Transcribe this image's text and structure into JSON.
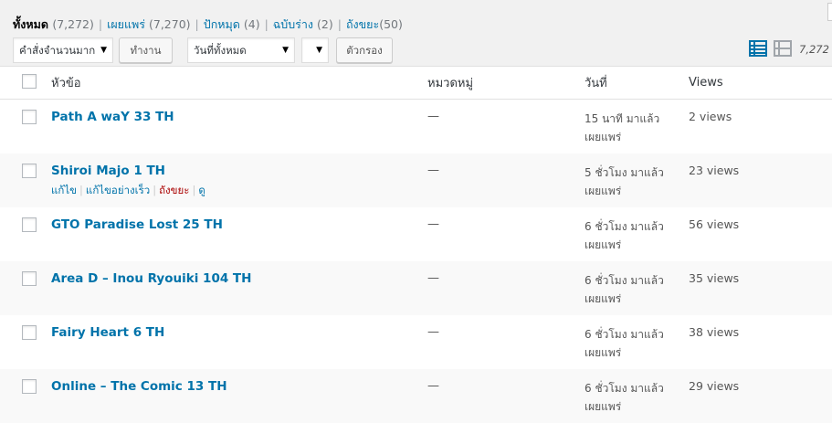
{
  "filters": {
    "all": {
      "label": "ทั้งหมด",
      "count": "(7,272)"
    },
    "published": {
      "label": "เผยแพร่",
      "count": "(7,270)"
    },
    "sticky": {
      "label": "ปักหมุด",
      "count": "(4)"
    },
    "drafts": {
      "label": "ฉบับร่าง",
      "count": "(2)"
    },
    "trash": {
      "label": "ถังขยะ",
      "count": "(50)"
    }
  },
  "toolbar": {
    "bulk_action": "คำสั่งจำนวนมาก",
    "apply_label": "ทำงาน",
    "date_filter": "วันที่ทั้งหมด",
    "category_filter": "",
    "filter_label": "ตัวกรอง",
    "items_count": "7,272 :"
  },
  "columns": {
    "title": "หัวข้อ",
    "categories": "หมวดหมู่",
    "date": "วันที่",
    "views": "Views"
  },
  "row_actions": {
    "edit": "แก้ไข",
    "quick_edit": "แก้ไขอย่างเร็ว",
    "trash": "ถังขยะ",
    "view": "ดู"
  },
  "posts": [
    {
      "title": "Path A waY 33 TH",
      "category": "—",
      "date": "15 นาที มาแล้ว",
      "status": "เผยแพร่",
      "views": "2 views"
    },
    {
      "title": "Shiroi Majo 1 TH",
      "category": "—",
      "date": "5 ชั่วโมง มาแล้ว",
      "status": "เผยแพร่",
      "views": "23 views"
    },
    {
      "title": "GTO Paradise Lost 25 TH",
      "category": "—",
      "date": "6 ชั่วโมง มาแล้ว",
      "status": "เผยแพร่",
      "views": "56 views"
    },
    {
      "title": "Area D – Inou Ryouiki 104 TH",
      "category": "—",
      "date": "6 ชั่วโมง มาแล้ว",
      "status": "เผยแพร่",
      "views": "35 views"
    },
    {
      "title": "Fairy Heart 6 TH",
      "category": "—",
      "date": "6 ชั่วโมง มาแล้ว",
      "status": "เผยแพร่",
      "views": "38 views"
    },
    {
      "title": "Online – The Comic 13 TH",
      "category": "—",
      "date": "6 ชั่วโมง มาแล้ว",
      "status": "เผยแพร่",
      "views": "29 views"
    }
  ],
  "colors": {
    "link": "#0073aa",
    "trash": "#a00",
    "active_view_icon": "#0073aa"
  },
  "icons": {
    "list_view": "list-view-icon",
    "excerpt_view": "excerpt-view-icon",
    "dropdown": "chevron-down-icon"
  }
}
